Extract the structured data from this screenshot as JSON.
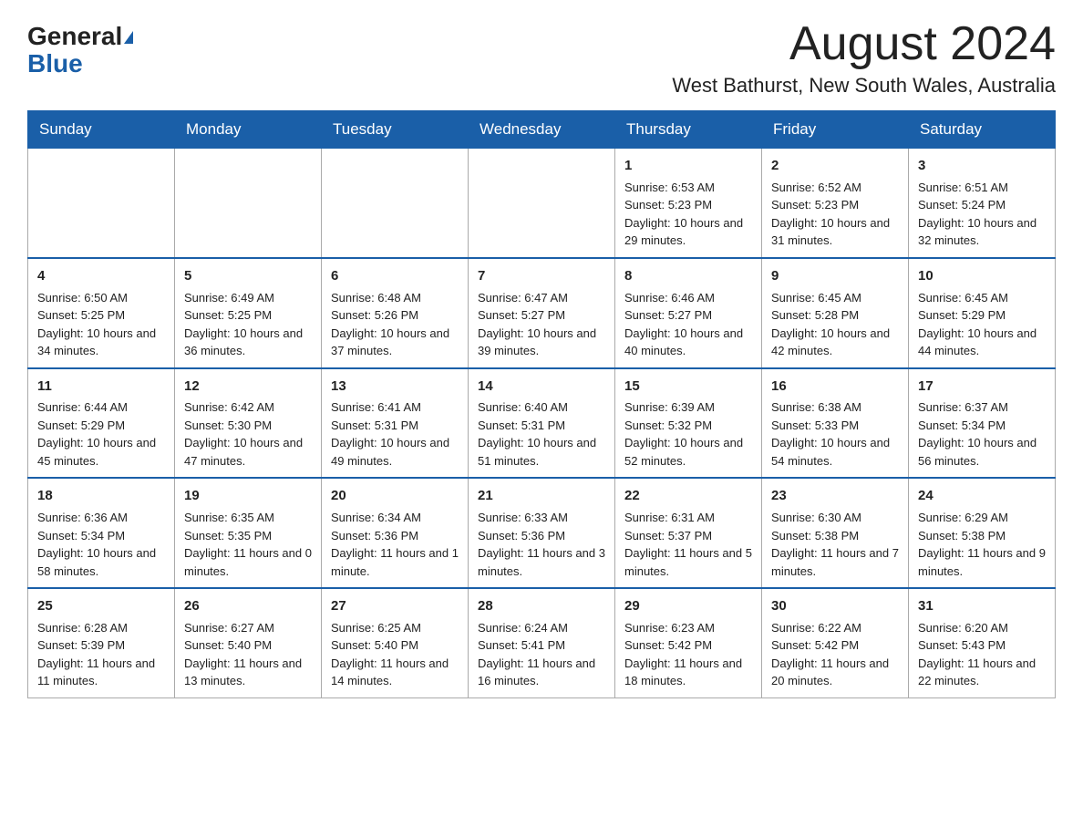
{
  "header": {
    "logo_general": "General",
    "logo_blue": "Blue",
    "month_title": "August 2024",
    "location": "West Bathurst, New South Wales, Australia"
  },
  "days_of_week": [
    "Sunday",
    "Monday",
    "Tuesday",
    "Wednesday",
    "Thursday",
    "Friday",
    "Saturday"
  ],
  "weeks": [
    {
      "days": [
        {
          "number": "",
          "info": ""
        },
        {
          "number": "",
          "info": ""
        },
        {
          "number": "",
          "info": ""
        },
        {
          "number": "",
          "info": ""
        },
        {
          "number": "1",
          "info": "Sunrise: 6:53 AM\nSunset: 5:23 PM\nDaylight: 10 hours and 29 minutes."
        },
        {
          "number": "2",
          "info": "Sunrise: 6:52 AM\nSunset: 5:23 PM\nDaylight: 10 hours and 31 minutes."
        },
        {
          "number": "3",
          "info": "Sunrise: 6:51 AM\nSunset: 5:24 PM\nDaylight: 10 hours and 32 minutes."
        }
      ]
    },
    {
      "days": [
        {
          "number": "4",
          "info": "Sunrise: 6:50 AM\nSunset: 5:25 PM\nDaylight: 10 hours and 34 minutes."
        },
        {
          "number": "5",
          "info": "Sunrise: 6:49 AM\nSunset: 5:25 PM\nDaylight: 10 hours and 36 minutes."
        },
        {
          "number": "6",
          "info": "Sunrise: 6:48 AM\nSunset: 5:26 PM\nDaylight: 10 hours and 37 minutes."
        },
        {
          "number": "7",
          "info": "Sunrise: 6:47 AM\nSunset: 5:27 PM\nDaylight: 10 hours and 39 minutes."
        },
        {
          "number": "8",
          "info": "Sunrise: 6:46 AM\nSunset: 5:27 PM\nDaylight: 10 hours and 40 minutes."
        },
        {
          "number": "9",
          "info": "Sunrise: 6:45 AM\nSunset: 5:28 PM\nDaylight: 10 hours and 42 minutes."
        },
        {
          "number": "10",
          "info": "Sunrise: 6:45 AM\nSunset: 5:29 PM\nDaylight: 10 hours and 44 minutes."
        }
      ]
    },
    {
      "days": [
        {
          "number": "11",
          "info": "Sunrise: 6:44 AM\nSunset: 5:29 PM\nDaylight: 10 hours and 45 minutes."
        },
        {
          "number": "12",
          "info": "Sunrise: 6:42 AM\nSunset: 5:30 PM\nDaylight: 10 hours and 47 minutes."
        },
        {
          "number": "13",
          "info": "Sunrise: 6:41 AM\nSunset: 5:31 PM\nDaylight: 10 hours and 49 minutes."
        },
        {
          "number": "14",
          "info": "Sunrise: 6:40 AM\nSunset: 5:31 PM\nDaylight: 10 hours and 51 minutes."
        },
        {
          "number": "15",
          "info": "Sunrise: 6:39 AM\nSunset: 5:32 PM\nDaylight: 10 hours and 52 minutes."
        },
        {
          "number": "16",
          "info": "Sunrise: 6:38 AM\nSunset: 5:33 PM\nDaylight: 10 hours and 54 minutes."
        },
        {
          "number": "17",
          "info": "Sunrise: 6:37 AM\nSunset: 5:34 PM\nDaylight: 10 hours and 56 minutes."
        }
      ]
    },
    {
      "days": [
        {
          "number": "18",
          "info": "Sunrise: 6:36 AM\nSunset: 5:34 PM\nDaylight: 10 hours and 58 minutes."
        },
        {
          "number": "19",
          "info": "Sunrise: 6:35 AM\nSunset: 5:35 PM\nDaylight: 11 hours and 0 minutes."
        },
        {
          "number": "20",
          "info": "Sunrise: 6:34 AM\nSunset: 5:36 PM\nDaylight: 11 hours and 1 minute."
        },
        {
          "number": "21",
          "info": "Sunrise: 6:33 AM\nSunset: 5:36 PM\nDaylight: 11 hours and 3 minutes."
        },
        {
          "number": "22",
          "info": "Sunrise: 6:31 AM\nSunset: 5:37 PM\nDaylight: 11 hours and 5 minutes."
        },
        {
          "number": "23",
          "info": "Sunrise: 6:30 AM\nSunset: 5:38 PM\nDaylight: 11 hours and 7 minutes."
        },
        {
          "number": "24",
          "info": "Sunrise: 6:29 AM\nSunset: 5:38 PM\nDaylight: 11 hours and 9 minutes."
        }
      ]
    },
    {
      "days": [
        {
          "number": "25",
          "info": "Sunrise: 6:28 AM\nSunset: 5:39 PM\nDaylight: 11 hours and 11 minutes."
        },
        {
          "number": "26",
          "info": "Sunrise: 6:27 AM\nSunset: 5:40 PM\nDaylight: 11 hours and 13 minutes."
        },
        {
          "number": "27",
          "info": "Sunrise: 6:25 AM\nSunset: 5:40 PM\nDaylight: 11 hours and 14 minutes."
        },
        {
          "number": "28",
          "info": "Sunrise: 6:24 AM\nSunset: 5:41 PM\nDaylight: 11 hours and 16 minutes."
        },
        {
          "number": "29",
          "info": "Sunrise: 6:23 AM\nSunset: 5:42 PM\nDaylight: 11 hours and 18 minutes."
        },
        {
          "number": "30",
          "info": "Sunrise: 6:22 AM\nSunset: 5:42 PM\nDaylight: 11 hours and 20 minutes."
        },
        {
          "number": "31",
          "info": "Sunrise: 6:20 AM\nSunset: 5:43 PM\nDaylight: 11 hours and 22 minutes."
        }
      ]
    }
  ]
}
